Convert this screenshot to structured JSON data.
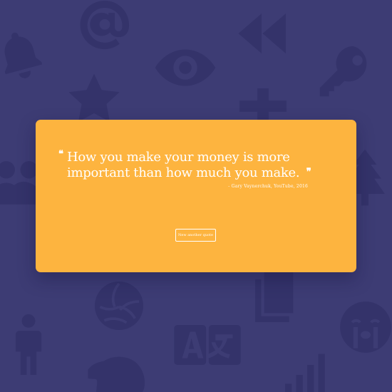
{
  "colors": {
    "background": "#3d3c74",
    "icon_fill": "#34336a",
    "card": "#fdb43f",
    "text": "#ffffff"
  },
  "background_icons": [
    "at-sign-icon",
    "bell-icon",
    "rewind-icon",
    "eye-icon",
    "key-icon",
    "star-icon",
    "plus-icon",
    "user-group-icon",
    "tree-icon",
    "volleyball-icon",
    "book-icon",
    "person-icon",
    "translate-icon",
    "crying-face-icon",
    "elephant-icon",
    "signal-bars-icon"
  ],
  "quote": {
    "open_mark": "❝",
    "text": "How you make your money is more important than how much you make.",
    "close_mark": "❞",
    "source": "- Gary Vaynerchuk, YouTube, 2016"
  },
  "new_quote_button": {
    "label": "New another quote"
  }
}
